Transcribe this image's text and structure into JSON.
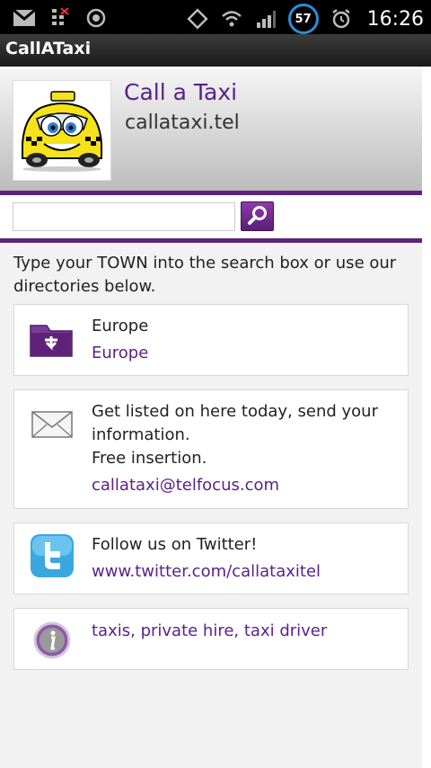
{
  "status_bar": {
    "battery_level": "57",
    "time": "16:26",
    "icons": [
      "gmail-icon",
      "missed-call-icon",
      "sync-icon",
      "rotation-icon",
      "wifi-icon",
      "signal-icon",
      "battery-icon",
      "alarm-icon"
    ]
  },
  "app": {
    "title": "CallATaxi"
  },
  "header": {
    "site_title": "Call a Taxi",
    "domain": "callataxi.tel",
    "logo_icon": "taxi-cartoon-logo"
  },
  "search": {
    "value": "",
    "placeholder": "",
    "button_icon": "magnifier-icon"
  },
  "intro_text": "Type your TOWN into the search box or use our directories below.",
  "cards": [
    {
      "icon": "folder-download-icon",
      "label": "Europe",
      "link": "Europe"
    },
    {
      "icon": "envelope-icon",
      "label": "Get listed on here today, send your information.",
      "label2": "Free insertion.",
      "link": "callataxi@telfocus.com"
    },
    {
      "icon": "twitter-icon",
      "label": "Follow us on Twitter!",
      "link": "www.twitter.com/callataxitel"
    },
    {
      "icon": "info-icon",
      "link": "taxis, private hire, taxi driver"
    }
  ],
  "colors": {
    "accent_purple": "#5e2378",
    "link_purple": "#5a1f8a",
    "battery_ring": "#2a8fd6",
    "taxi_yellow": "#f5e21a"
  }
}
